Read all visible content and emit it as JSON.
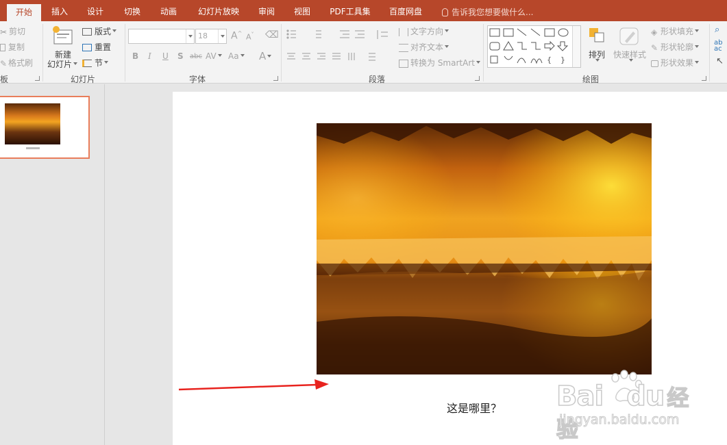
{
  "tabs": [
    {
      "label": "开始",
      "active": true
    },
    {
      "label": "插入"
    },
    {
      "label": "设计"
    },
    {
      "label": "切换"
    },
    {
      "label": "动画"
    },
    {
      "label": "幻灯片放映"
    },
    {
      "label": "审阅"
    },
    {
      "label": "视图"
    },
    {
      "label": "PDF工具集"
    },
    {
      "label": "百度网盘"
    }
  ],
  "tell_me": "告诉我您想要做什么...",
  "clipboard": {
    "cut": "剪切",
    "copy": "复制",
    "format_painter": "格式刷",
    "group_label": "板"
  },
  "slides_group": {
    "new_slide_line1": "新建",
    "new_slide_line2": "幻灯片",
    "layout": "版式",
    "reset": "重置",
    "section": "节",
    "group_label": "幻灯片"
  },
  "font_group": {
    "font_name": "",
    "font_size": "18",
    "bold": "B",
    "italic": "I",
    "underline": "U",
    "shadow": "S",
    "strike": "abc",
    "spacing": "AV",
    "case": "Aa",
    "color": "A",
    "grow": "A",
    "shrink": "A",
    "group_label": "字体"
  },
  "paragraph_group": {
    "text_direction": "文字方向",
    "align_text": "对齐文本",
    "convert_smartart": "转换为 SmartArt",
    "group_label": "段落"
  },
  "drawing_group": {
    "arrange": "排列",
    "quick_styles": "快速样式",
    "shape_fill": "形状填充",
    "shape_outline": "形状轮廓",
    "shape_effects": "形状效果",
    "group_label": "绘图"
  },
  "slide_content": {
    "caption": "这是哪里？"
  },
  "watermark": {
    "brand": "Bai",
    "brand2": "du",
    "cn": "经验",
    "url": "jingyan.baidu.com"
  },
  "colors": {
    "accent": "#b7472a",
    "ribbon_bg": "#f3f3f3",
    "selection_border": "#e97d5a",
    "arrow": "#e8231e"
  }
}
